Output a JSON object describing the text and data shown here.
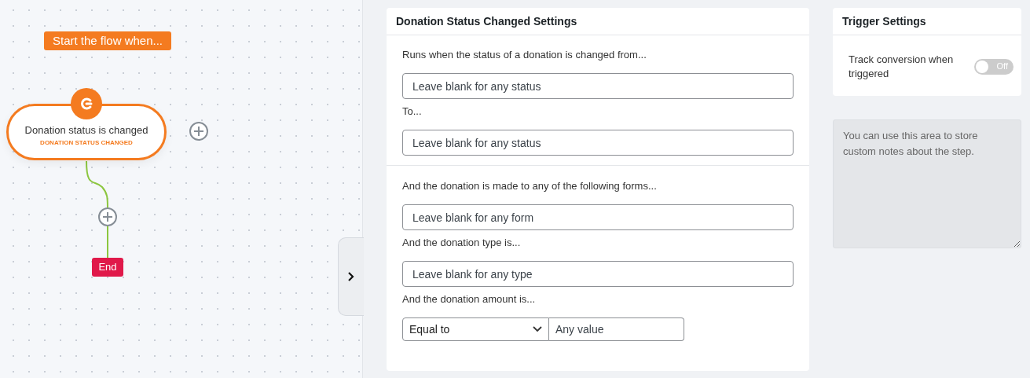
{
  "canvas": {
    "start_label": "Start the flow when...",
    "trigger_node": {
      "title": "Donation status is changed",
      "subtitle": "DONATION STATUS CHANGED"
    },
    "end_label": "End"
  },
  "settings": {
    "title": "Donation Status Changed Settings",
    "sections": [
      {
        "fields": [
          {
            "kind": "text",
            "label": "Runs when the status of a donation is changed from...",
            "placeholder": "Leave blank for any status"
          },
          {
            "kind": "text",
            "label": "To...",
            "placeholder": "Leave blank for any status"
          }
        ]
      },
      {
        "fields": [
          {
            "kind": "text",
            "label": "And the donation is made to any of the following forms...",
            "placeholder": "Leave blank for any form"
          },
          {
            "kind": "text",
            "label": "And the donation type is...",
            "placeholder": "Leave blank for any type"
          },
          {
            "kind": "amount",
            "label": "And the donation amount is...",
            "select_value": "Equal to",
            "placeholder": "Any value"
          }
        ]
      }
    ]
  },
  "trigger_settings": {
    "title": "Trigger Settings",
    "track_conversion": {
      "label": "Track conversion when triggered",
      "on": false,
      "state_label": "Off"
    }
  },
  "notes": {
    "placeholder": "You can use this area to store custom notes about the step."
  }
}
